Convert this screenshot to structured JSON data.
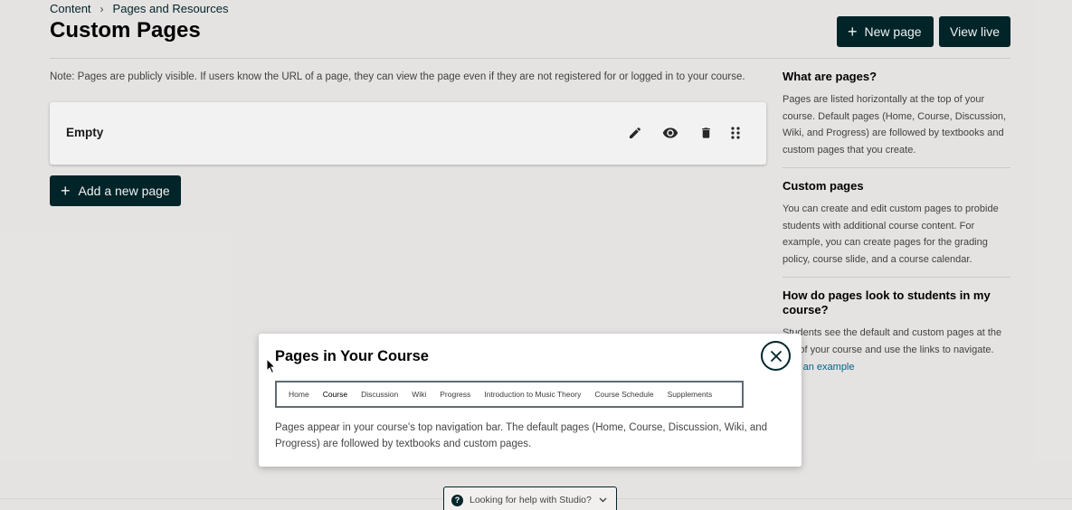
{
  "breadcrumb": {
    "items": [
      "Content",
      "Pages and Resources"
    ],
    "separator": "›"
  },
  "header": {
    "title": "Custom Pages",
    "new_page_label": "New page",
    "view_live_label": "View live"
  },
  "note": "Note: Pages are publicly visible. If users know the URL of a page, they can view the page even if they are not registered for or logged in to your course.",
  "pages": [
    {
      "name": "Empty"
    }
  ],
  "add_page_label": "Add a new page",
  "sidebar": {
    "sections": [
      {
        "title": "What are pages?",
        "body": "Pages are listed horizontally at the top of your course. Default pages (Home, Course, Discussion, Wiki, and Progress) are followed by textbooks and custom pages that you create."
      },
      {
        "title": "Custom pages",
        "body": "You can create and edit custom pages to probide students with additional course content. For example, you can create pages for the grading policy, course slide, and a course calendar."
      },
      {
        "title": "How do pages look to students in my course?",
        "body": "Students see the default and custom pages at the top of your course and use the links to navigate.",
        "link": "See an example"
      }
    ]
  },
  "modal": {
    "title": "Pages in Your Course",
    "nav_items": [
      "Home",
      "Course",
      "Discussion",
      "Wiki",
      "Progress",
      "Introduction to Music Theory",
      "Course Schedule",
      "Supplements"
    ],
    "active_nav": "Course",
    "text": "Pages appear in your course's top navigation bar. The default pages (Home, Course, Discussion, Wiki, and Progress) are followed by textbooks and custom pages."
  },
  "footer": {
    "help_label": "Looking for help with Studio?"
  },
  "colors": {
    "primary": "#00262b",
    "background": "#f2f0ef",
    "link": "#00688d"
  }
}
